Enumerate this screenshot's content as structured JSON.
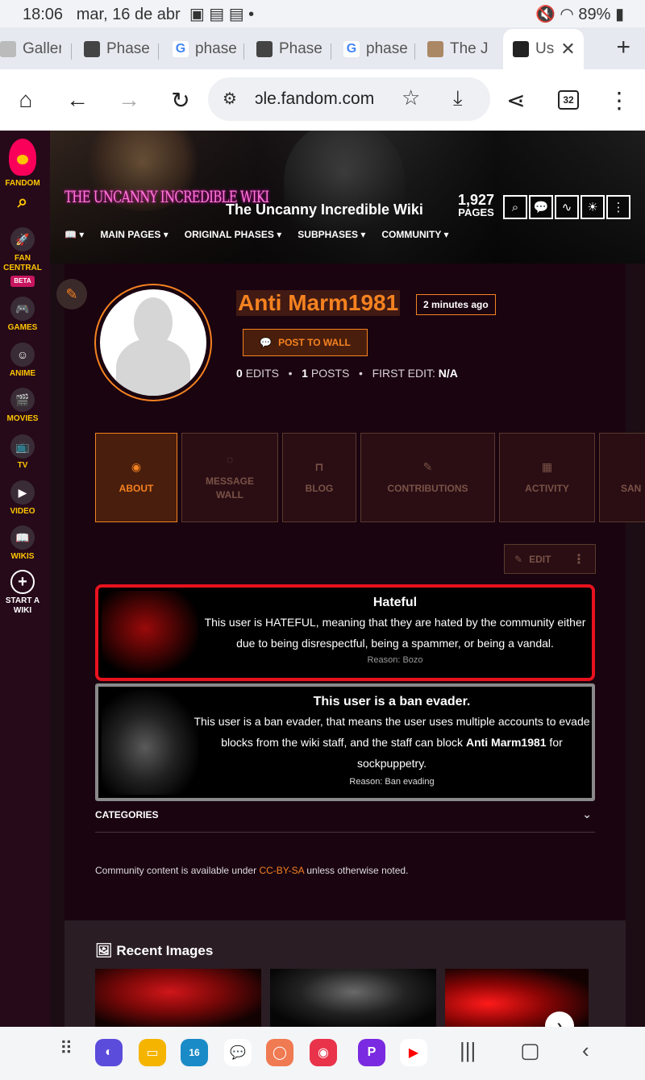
{
  "status": {
    "time": "18:06",
    "date": "mar, 16 de abr",
    "battery": "89%"
  },
  "tabs": [
    {
      "label": "Galler",
      "fav": "#999"
    },
    {
      "label": "Phase",
      "fav": "#444"
    },
    {
      "label": "phase",
      "fav": "#4285f4"
    },
    {
      "label": "Phase",
      "fav": "#444"
    },
    {
      "label": "phase",
      "fav": "#4285f4"
    },
    {
      "label": "The J",
      "fav": "#a86"
    },
    {
      "label": "Us",
      "fav": "#222"
    }
  ],
  "toolbar": {
    "url": "ɔle.fandom.com",
    "tab_count": "32"
  },
  "rail": {
    "fandom": "FANDOM",
    "fan_central": "FAN CENTRAL",
    "beta": "BETA",
    "games": "GAMES",
    "anime": "ANIME",
    "movies": "MOVIES",
    "tv": "TV",
    "video": "VIDEO",
    "wikis": "WIKIS",
    "start_a_wiki": "START A WIKI"
  },
  "header": {
    "logo_text": "THE UNCANNY INCREDIBLE WIKI",
    "wiki_name": "The Uncanny Incredible Wiki",
    "pages_count": "1,927",
    "pages_label": "PAGES",
    "nav": [
      "MAIN PAGES",
      "ORIGINAL PHASES",
      "SUBPHASES",
      "COMMUNITY"
    ]
  },
  "profile": {
    "username": "Anti Marm1981",
    "last_seen": "2 minutes ago",
    "post_to_wall": "POST TO WALL",
    "edits_count": "0",
    "edits_label": "EDITS",
    "posts_count": "1",
    "posts_label": "POSTS",
    "first_edit_label": "FIRST EDIT:",
    "first_edit_value": "N/A"
  },
  "profile_tabs": [
    "ABOUT",
    "MESSAGE WALL",
    "BLOG",
    "CONTRIBUTIONS",
    "ACTIVITY",
    "SAN"
  ],
  "edit_label": "EDIT",
  "notices": {
    "hateful": {
      "title": "Hateful",
      "text": "This user is HATEFUL, meaning that they are hated by the community either due to being disrespectful, being a spammer, or being a vandal.",
      "reason": "Reason: Bozo"
    },
    "ban": {
      "title": "This user is a ban evader.",
      "text_before": "This user is a ban evader, that means the user uses multiple accounts to evade blocks from the wiki staff, and the staff can block ",
      "text_name": "Anti Marm1981",
      "text_after": " for sockpuppetry.",
      "reason": "Reason: Ban evading"
    }
  },
  "categories_label": "CATEGORIES",
  "license": {
    "before": "Community content is available under ",
    "link": "CC-BY-SA",
    "after": " unless otherwise noted."
  },
  "recent_images_title": "Recent Images",
  "colors": {
    "accent": "#f58220",
    "rail": "#260a1a",
    "page_bg": "#1a0410",
    "danger": "#e8121f"
  }
}
